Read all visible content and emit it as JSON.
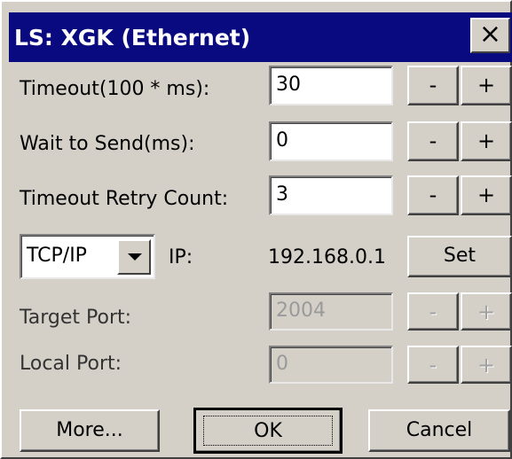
{
  "window": {
    "title": "LS: XGK (Ethernet)",
    "close_label": "×"
  },
  "fields": {
    "timeout": {
      "label": "Timeout(100 * ms):",
      "value": "30",
      "minus": "-",
      "plus": "+"
    },
    "wait": {
      "label": "Wait to Send(ms):",
      "value": "0",
      "minus": "-",
      "plus": "+"
    },
    "retry": {
      "label": "Timeout Retry Count:",
      "value": "3",
      "minus": "-",
      "plus": "+"
    },
    "target_port": {
      "label": "Target Port:",
      "value": "2004",
      "minus": "-",
      "plus": "+"
    },
    "local_port": {
      "label": "Local Port:",
      "value": "0",
      "minus": "-",
      "plus": "+"
    }
  },
  "network": {
    "protocol": "TCP/IP",
    "ip_label": "IP:",
    "ip_value": "192.168.0.1",
    "set_label": "Set"
  },
  "buttons": {
    "more": "More...",
    "ok": "OK",
    "cancel": "Cancel"
  },
  "colors": {
    "titlebar": "#0a0a80",
    "face": "#d4d0c8"
  }
}
